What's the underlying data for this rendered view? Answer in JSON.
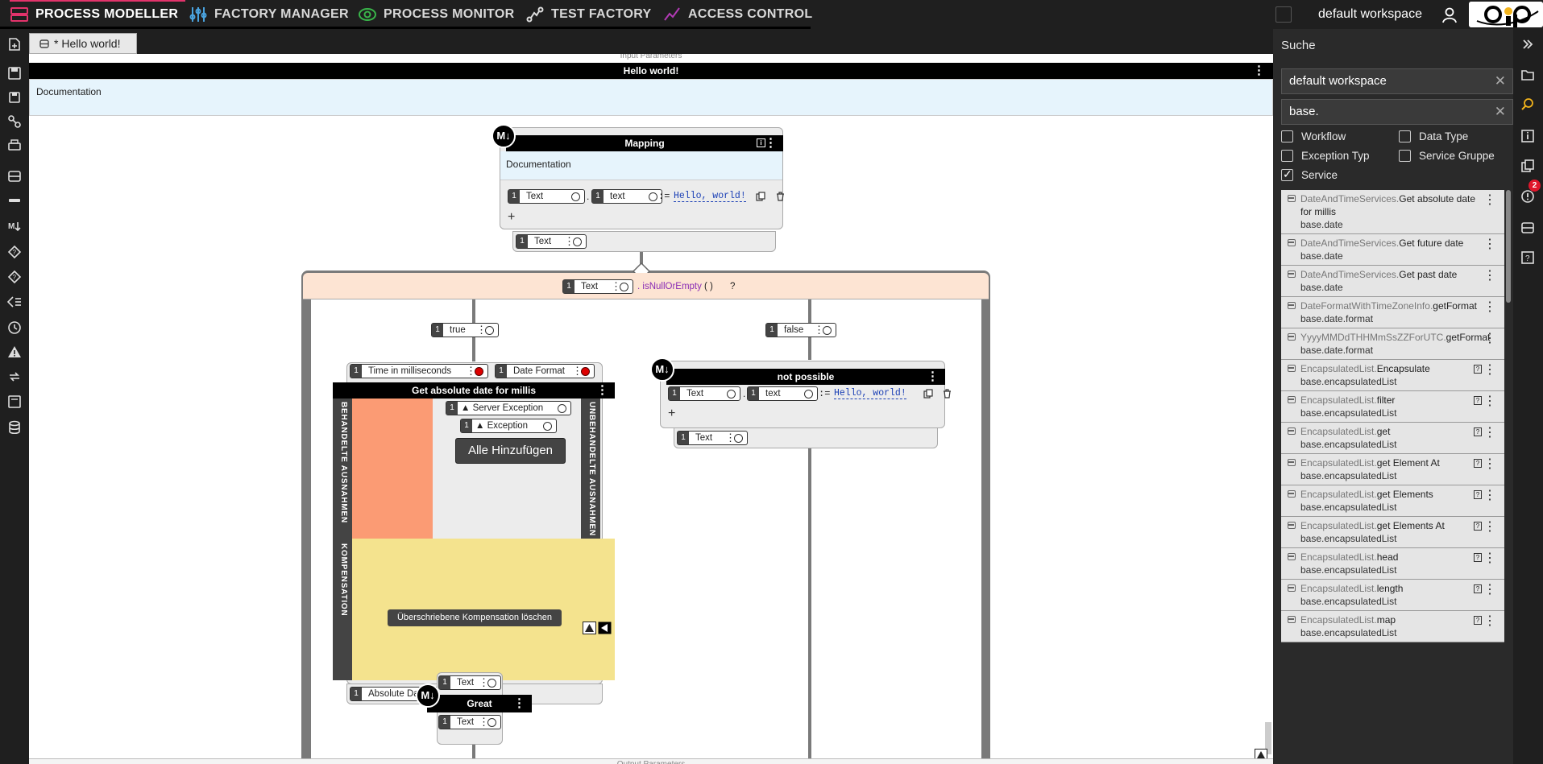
{
  "nav": {
    "tabs": [
      {
        "label": "PROCESS MODELLER",
        "icon": "process-modeller-icon"
      },
      {
        "label": "FACTORY MANAGER",
        "icon": "factory-manager-icon"
      },
      {
        "label": "PROCESS MONITOR",
        "icon": "process-monitor-icon"
      },
      {
        "label": "TEST FACTORY",
        "icon": "test-factory-icon"
      },
      {
        "label": "ACCESS CONTROL",
        "icon": "access-control-icon"
      }
    ],
    "workspace": "default workspace",
    "colors": {
      "accent": "#e2336b",
      "monitor": "#39b54a",
      "access": "#b23ab5"
    }
  },
  "document_tab": "* Hello world!",
  "workflow": {
    "input_params_label": "Input Parameters",
    "title": "Hello world!",
    "documentation": "Documentation",
    "output_params_label": "Output Parameters"
  },
  "mapping": {
    "badge": "M↓",
    "title": "Mapping",
    "documentation": "Documentation",
    "left_var": {
      "num": "1",
      "label": "Text"
    },
    "dot": ".",
    "member_var": {
      "num": "1",
      "label": "text"
    },
    "assign": ":=",
    "value": "Hello, world!",
    "add": "+",
    "output_var": {
      "num": "1",
      "label": "Text"
    }
  },
  "condition": {
    "var": {
      "num": "1",
      "label": "Text"
    },
    "expression": ". isNullOrEmpty",
    "parens": "( )",
    "question": "?",
    "true_label": "true",
    "false_label": "false",
    "branch_num": "1"
  },
  "service_call": {
    "inputs": [
      {
        "num": "1",
        "label": "Time in milliseconds"
      },
      {
        "num": "1",
        "label": "Date Format"
      }
    ],
    "title": "Get absolute date for millis",
    "handled_label": "BEHANDELTE AUSNAHMEN",
    "unhandled_label": "UNBEHANDELTE AUSNAHMEN",
    "compensation_label": "KOMPENSATION",
    "exceptions": [
      {
        "num": "1",
        "label": "▲ Server Exception"
      },
      {
        "num": "1",
        "label": "▲ Exception"
      }
    ],
    "add_all_button": "Alle Hinzufügen",
    "delete_comp_button": "Überschriebene Kompensation löschen",
    "output": {
      "num": "1",
      "label": "Absolute Date"
    },
    "colors": {
      "handled": "#fb9b74",
      "compensation": "#f4e38e"
    }
  },
  "not_possible": {
    "badge": "M↓",
    "title": "not possible",
    "left_var": {
      "num": "1",
      "label": "Text"
    },
    "member_var": {
      "num": "1",
      "label": "text"
    },
    "value": "Hello, world!",
    "output_var": {
      "num": "1",
      "label": "Text"
    }
  },
  "great": {
    "badge": "M↓",
    "title": "Great",
    "input_var": {
      "num": "1",
      "label": "Text"
    },
    "output_var": {
      "num": "1",
      "label": "Text"
    }
  },
  "search_panel": {
    "title": "Suche",
    "workspace_value": "default workspace",
    "query_value": "base.",
    "filters": [
      {
        "label": "Workflow",
        "checked": false
      },
      {
        "label": "Data Type",
        "checked": false
      },
      {
        "label": "Exception Typ",
        "checked": false
      },
      {
        "label": "Service Gruppe",
        "checked": false
      },
      {
        "label": "Service",
        "checked": true
      }
    ],
    "results": [
      {
        "group": "DateAndTimeServices.",
        "name": "Get absolute date for millis",
        "pkg": "base.date",
        "info": false
      },
      {
        "group": "DateAndTimeServices.",
        "name": "Get future date",
        "pkg": "base.date",
        "info": false
      },
      {
        "group": "DateAndTimeServices.",
        "name": "Get past date",
        "pkg": "base.date",
        "info": false
      },
      {
        "group": "DateFormatWithTimeZoneInfo.",
        "name": "getFormat",
        "pkg": "base.date.format",
        "info": false
      },
      {
        "group": "YyyyMMDdTHHMmSsZZForUTC.",
        "name": "getFormat",
        "pkg": "base.date.format",
        "info": false
      },
      {
        "group": "EncapsulatedList.",
        "name": "Encapsulate",
        "pkg": "base.encapsulatedList",
        "info": true
      },
      {
        "group": "EncapsulatedList.",
        "name": "filter",
        "pkg": "base.encapsulatedList",
        "info": true
      },
      {
        "group": "EncapsulatedList.",
        "name": "get",
        "pkg": "base.encapsulatedList",
        "info": true
      },
      {
        "group": "EncapsulatedList.",
        "name": "get Element At",
        "pkg": "base.encapsulatedList",
        "info": true
      },
      {
        "group": "EncapsulatedList.",
        "name": "get Elements",
        "pkg": "base.encapsulatedList",
        "info": true
      },
      {
        "group": "EncapsulatedList.",
        "name": "get Elements At",
        "pkg": "base.encapsulatedList",
        "info": true
      },
      {
        "group": "EncapsulatedList.",
        "name": "head",
        "pkg": "base.encapsulatedList",
        "info": true
      },
      {
        "group": "EncapsulatedList.",
        "name": "length",
        "pkg": "base.encapsulatedList",
        "info": true
      },
      {
        "group": "EncapsulatedList.",
        "name": "map",
        "pkg": "base.encapsulatedList",
        "info": true
      }
    ],
    "notification_count": "2"
  }
}
